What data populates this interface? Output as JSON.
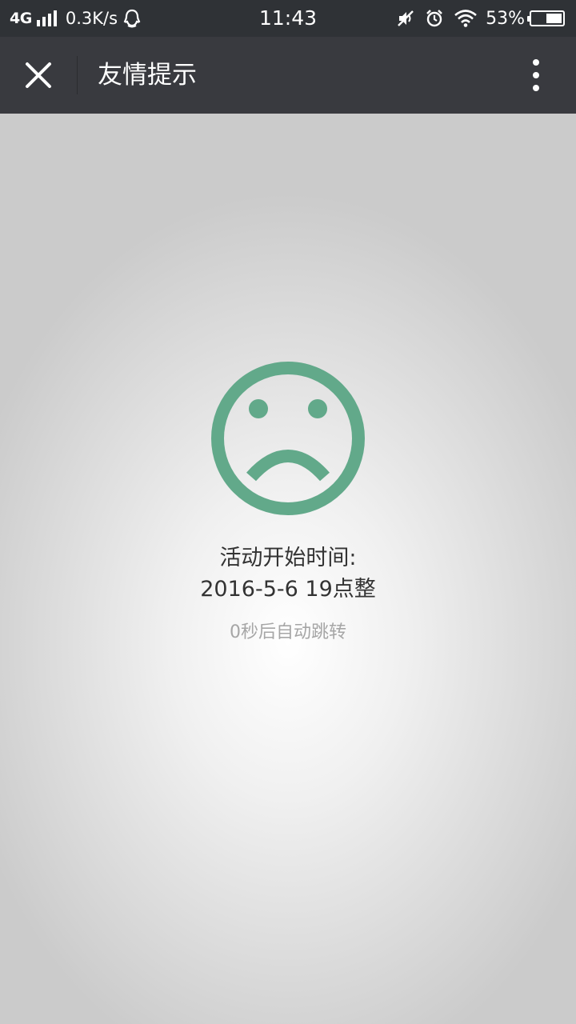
{
  "status_bar": {
    "network": "4G",
    "speed": "0.3K/s",
    "time": "11:43",
    "battery": "53%",
    "battery_level": 0.53,
    "icons": [
      "signal-icon",
      "qq-icon",
      "mute-icon",
      "alarm-icon",
      "wifi-icon",
      "battery-icon"
    ]
  },
  "title_bar": {
    "title": "友情提示",
    "close_icon": "close-icon",
    "more_icon": "more-vertical-icon"
  },
  "content": {
    "icon": "sad-face-icon",
    "accent_color": "#62a98a",
    "line1": "活动开始时间:",
    "line2": "2016-5-6 19点整",
    "redirect": "0秒后自动跳转"
  }
}
